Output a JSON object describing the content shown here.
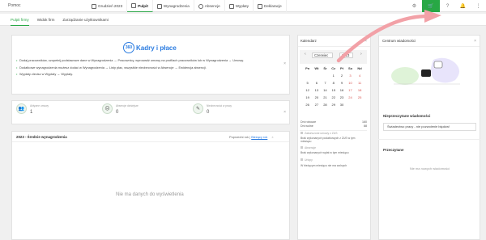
{
  "topbar": {
    "help": "Pomoc",
    "nav": [
      {
        "label": "Grudzień 2023",
        "icon": "calendar-icon"
      },
      {
        "label": "Pulpit",
        "icon": "dashboard-icon",
        "active": true
      },
      {
        "label": "Wynagrodzenia",
        "icon": "wallet-icon"
      },
      {
        "label": "Absencje",
        "icon": "clock-icon"
      },
      {
        "label": "Wypłaty",
        "icon": "payment-icon"
      },
      {
        "label": "Deklaracje",
        "icon": "document-icon"
      }
    ],
    "right": {
      "gear": "⚙",
      "cart": "🛒",
      "help": "?",
      "bell": "🔔",
      "more": "⋮"
    }
  },
  "subnav": {
    "tabs": [
      "Pulpit firmy",
      "Widok firm",
      "Zarządzanie użytkownikami"
    ]
  },
  "welcome": {
    "logo_badge": "360",
    "logo_text": "Kadry i płace",
    "bullets": [
      "Dodaj pracowników, uzupełnij podstawowe dane w Wynagrodzenia → Pracownicy, wprowadź umowy na profilach pracowników lub w Wynagrodzenia → Umowy.",
      "Dodatkowe wynagrodzenia możesz dodać w Wynagrodzenia → Listy płac, wszystkie nieobecności w Absencje → Ewidencja absencji.",
      "Wypłaty zlecisz w Wypłaty → Wypłaty."
    ]
  },
  "stats": [
    {
      "label": "Aktywne umowy",
      "value": "1",
      "icon": "users-icon"
    },
    {
      "label": "Absencje dzisiejsze",
      "value": "0",
      "icon": "absence-icon"
    },
    {
      "label": "Nieobecności w pracy",
      "value": "0",
      "icon": "syringe-icon"
    }
  ],
  "salaries": {
    "title": "2023 - Średnie wynagrodzenia",
    "prev_year": "Poprzedni rok",
    "current_year": "Bieżący rok",
    "empty": "Nie ma danych do wyświetlenia"
  },
  "calendar": {
    "title": "Kalendarz",
    "month": "Czerwiec",
    "year": "2023",
    "days_header": [
      "Pn",
      "Wt",
      "Śr",
      "Cz",
      "Pt",
      "So",
      "Nd"
    ],
    "weeks": [
      [
        "",
        "",
        "",
        "1",
        "2",
        "3",
        "4"
      ],
      [
        "5",
        "6",
        "7",
        "8",
        "9",
        "10",
        "11"
      ],
      [
        "12",
        "13",
        "14",
        "15",
        "16",
        "17",
        "18"
      ],
      [
        "19",
        "20",
        "21",
        "22",
        "23",
        "24",
        "25"
      ],
      [
        "26",
        "27",
        "28",
        "29",
        "30",
        "",
        ""
      ]
    ],
    "summary": [
      {
        "label": "Dni robocze",
        "value": "160"
      },
      {
        "label": "Dni wolne",
        "value": "88"
      }
    ],
    "legend": [
      "Zakończone umowy z ZUS",
      "Brak wykonanych podatkowych z ZUS w tym miesiącu",
      "Absencje",
      "Brak wykonanych wpłat w tym miesiącu"
    ],
    "legend_more": [
      "Urlopy",
      "W bieżącym miesiącu nie ma wolnych"
    ]
  },
  "messages": {
    "title": "Centrum wiadomości",
    "unread_title": "Nieprzeczytane wiadomości",
    "unread_item": "Świadectwo pracy - nie pozwolenie błędów!",
    "read_title": "Przeczytane",
    "no_read": "Nie ma nowych wiadomości"
  },
  "colors": {
    "accent": "#27a845",
    "link": "#2a7be0",
    "weekend": "#d9534f"
  }
}
